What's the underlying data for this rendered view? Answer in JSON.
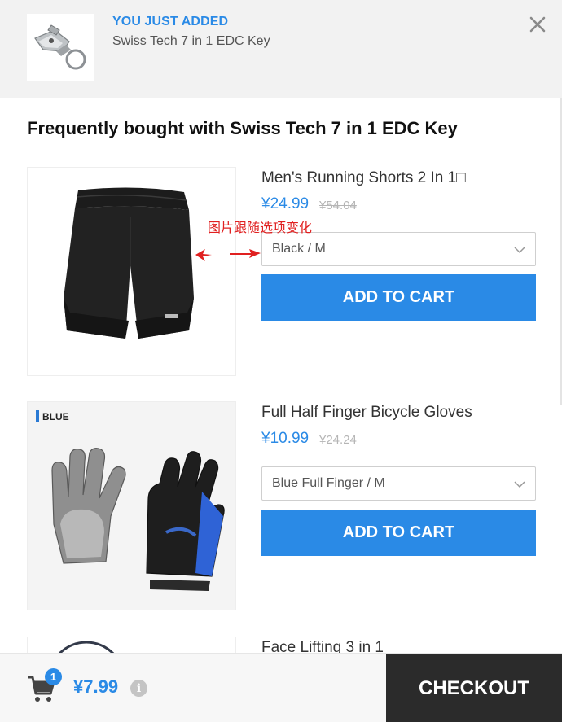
{
  "notification": {
    "added_label": "YOU JUST ADDED",
    "product_name": "Swiss Tech 7 in 1 EDC Key",
    "thumbnail": "keychain-tool-image",
    "close_icon": "close-icon"
  },
  "section_title": "Frequently bought with Swiss Tech 7 in 1 EDC Key",
  "annotation": {
    "text": "图片跟随选项变化",
    "color": "#e02020"
  },
  "products": [
    {
      "name": "Men's Running Shorts 2 In 1□",
      "price": "¥24.99",
      "old_price": "¥54.04",
      "variant": "Black / M",
      "button_label": "ADD TO CART",
      "image": "running-shorts-image"
    },
    {
      "name": "Full Half Finger Bicycle Gloves",
      "price": "¥10.99",
      "old_price": "¥24.24",
      "variant": "Blue Full Finger / M",
      "button_label": "ADD TO CART",
      "image": "bicycle-gloves-image",
      "image_badge": "BLUE"
    },
    {
      "name": "Face Lifting 3 in 1",
      "image": "face-lifting-image"
    }
  ],
  "cart": {
    "count": "1",
    "total": "¥7.99",
    "checkout_label": "CHECKOUT",
    "icons": [
      "cart-icon",
      "info-icon"
    ]
  },
  "colors": {
    "accent": "#2a8ae6",
    "checkout_bg": "#2b2b2b",
    "header_bg": "#f2f2f2"
  }
}
